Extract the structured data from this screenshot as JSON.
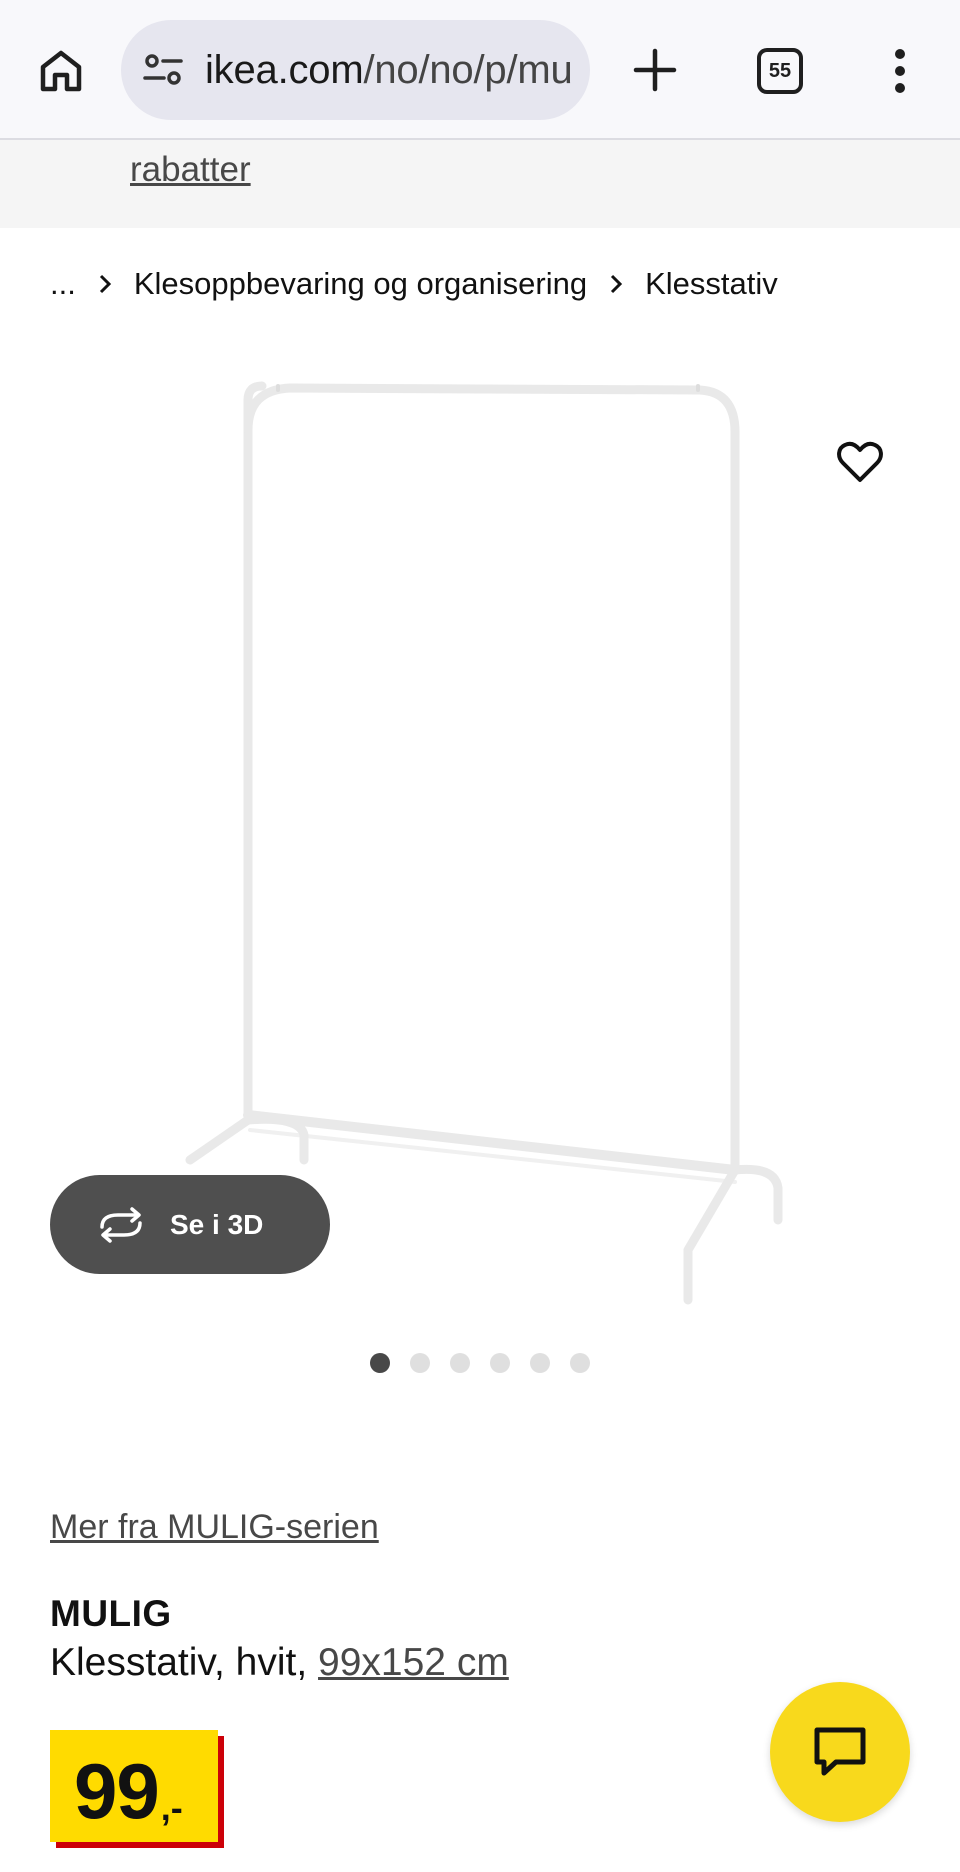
{
  "browser": {
    "url_host": "ikea.com",
    "url_path": "/no/no/p/mu",
    "tab_count": "55"
  },
  "banner": {
    "link_label": "rabatter"
  },
  "breadcrumb": {
    "ellipsis": "...",
    "items": [
      "Klesoppbevaring og organisering",
      "Klesstativ"
    ]
  },
  "gallery": {
    "view_3d_label": "Se i 3D",
    "dot_count": 6,
    "active_dot": 1
  },
  "product": {
    "series_link": "Mer fra MULIG-serien",
    "name": "MULIG",
    "description": "Klesstativ, hvit, ",
    "measurement": "99x152 cm",
    "price": "99",
    "price_suffix": ",-"
  },
  "colors": {
    "price_yellow": "#ffdb00",
    "price_red_shadow": "#cc0008",
    "chat_yellow": "#f8d91c",
    "button_3d": "#4f4f4f"
  },
  "icons": {
    "home": "home-icon",
    "site_info": "tune-icon",
    "new_tab": "plus-icon",
    "menu": "more-vert-icon",
    "favorite": "heart-icon",
    "rotate_3d": "rotate-3d-icon",
    "chat": "chat-icon",
    "chevron": "chevron-right-icon"
  }
}
